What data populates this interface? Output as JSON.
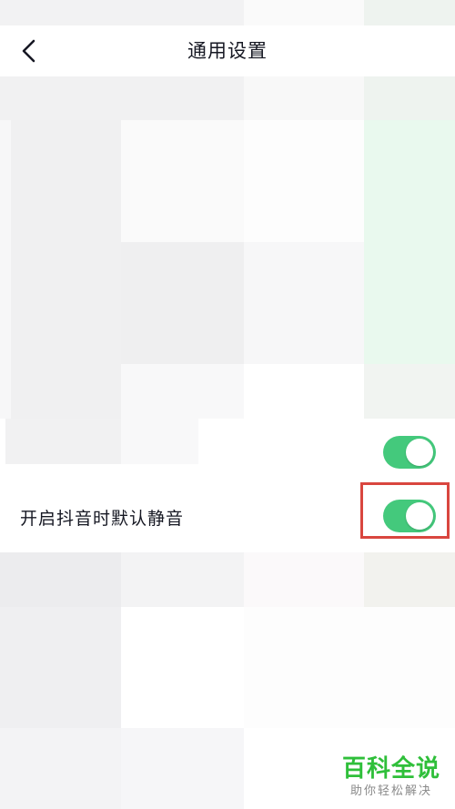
{
  "header": {
    "title": "通用设置",
    "back_icon": "chevron-left-icon"
  },
  "settings": {
    "row_upper": {
      "label": "",
      "enabled": true
    },
    "row_mute": {
      "label": "开启抖音时默认静音",
      "enabled": true
    }
  },
  "annotation": {
    "color": "#d9463f"
  },
  "colors": {
    "toggle_on": "#44c97c",
    "watermark": "#2fbf3a"
  },
  "watermark": {
    "title": "百科全说",
    "subtitle": "助你轻松解决"
  }
}
